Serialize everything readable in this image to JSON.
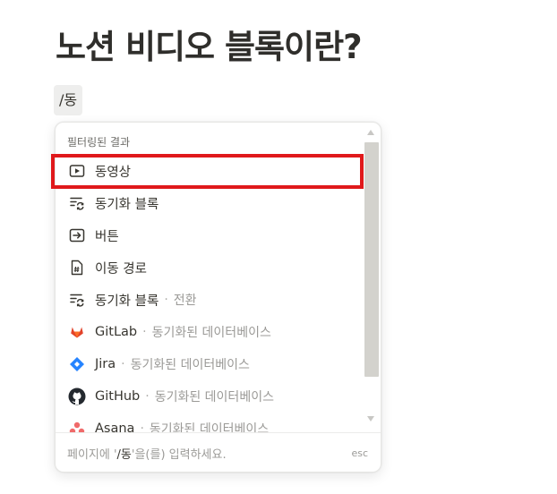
{
  "page": {
    "title": "노션 비디오 블록이란?",
    "slash_query": "/동"
  },
  "menu": {
    "header": "필터링된 결과",
    "items": [
      {
        "label": "동영상",
        "icon": "video-play-icon"
      },
      {
        "label": "동기화 블록",
        "icon": "synced-block-icon"
      },
      {
        "label": "버튼",
        "icon": "button-arrow-icon"
      },
      {
        "label": "이동 경로",
        "icon": "breadcrumb-page-icon"
      },
      {
        "label": "동기화 블록",
        "sep": "·",
        "sub": "전환",
        "icon": "synced-block-icon"
      },
      {
        "label": "GitLab",
        "sep": "·",
        "sub": "동기화된 데이터베이스",
        "icon": "gitlab-logo-icon"
      },
      {
        "label": "Jira",
        "sep": "·",
        "sub": "동기화된 데이터베이스",
        "icon": "jira-logo-icon"
      },
      {
        "label": "GitHub",
        "sep": "·",
        "sub": "동기화된 데이터베이스",
        "icon": "github-logo-icon"
      },
      {
        "label": "Asana",
        "sep": "·",
        "sub": "동기화된 데이터베이스",
        "icon": "asana-logo-icon"
      }
    ],
    "footer": {
      "hint_prefix": "페이지에 '",
      "hint_query": "/동",
      "hint_suffix": "'을(를) 입력하세요.",
      "esc": "esc"
    }
  },
  "colors": {
    "highlight": "#e0191b",
    "gitlab": "#e2432a",
    "jira": "#2684ff",
    "asana": "#f06a6a"
  }
}
